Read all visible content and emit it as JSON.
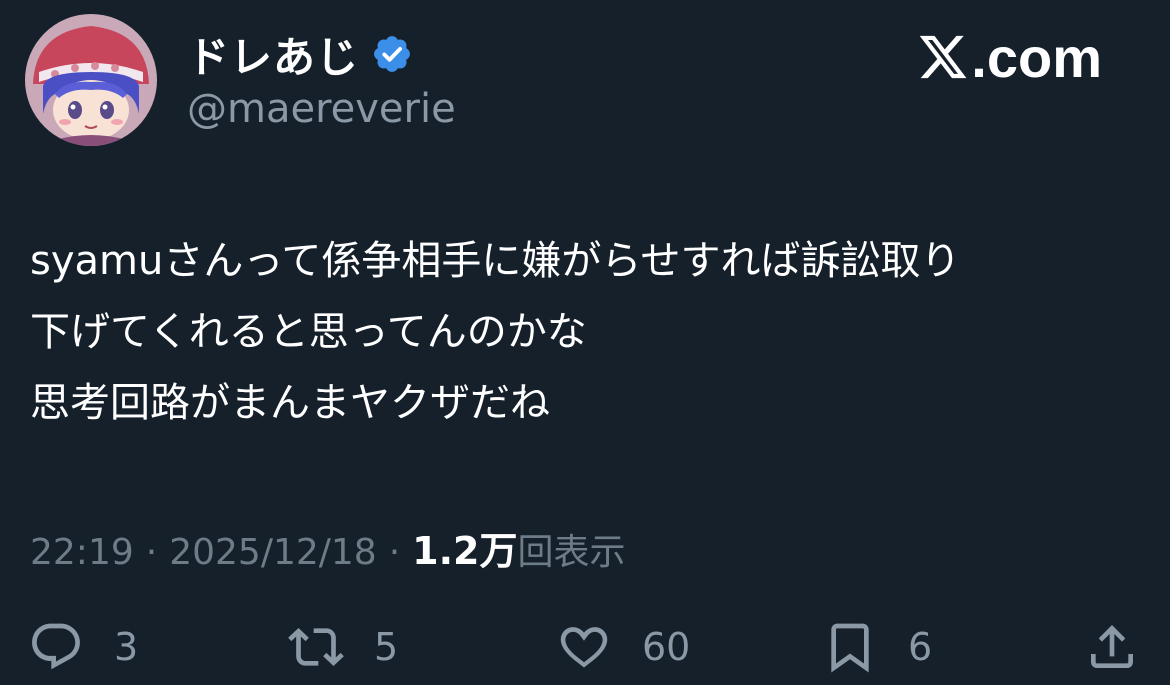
{
  "author": {
    "display_name": "ドレあじ",
    "handle": "@maereverie",
    "verified": true,
    "verified_color": "#3b8fe8"
  },
  "site_mark": {
    "icon": "x-logo-icon",
    "suffix": ".com"
  },
  "tweet": {
    "lines": [
      "syamuさんって係争相手に嫌がらせすれば訴訟取り",
      "下げてくれると思ってんのかな",
      "思考回路がまんまヤクザだね"
    ]
  },
  "meta": {
    "time": "22:19",
    "separator": "·",
    "date": "2025/12/18",
    "views_count": "1.2万",
    "views_label": "回表示"
  },
  "actions": {
    "reply": {
      "icon": "reply-icon",
      "count": "3"
    },
    "retweet": {
      "icon": "retweet-icon",
      "count": "5"
    },
    "like": {
      "icon": "heart-icon",
      "count": "60"
    },
    "bookmark": {
      "icon": "bookmark-icon",
      "count": "6"
    },
    "share": {
      "icon": "share-icon"
    }
  },
  "colors": {
    "background": "#15202b",
    "text_primary": "#ffffff",
    "text_secondary": "#8b98a5"
  }
}
